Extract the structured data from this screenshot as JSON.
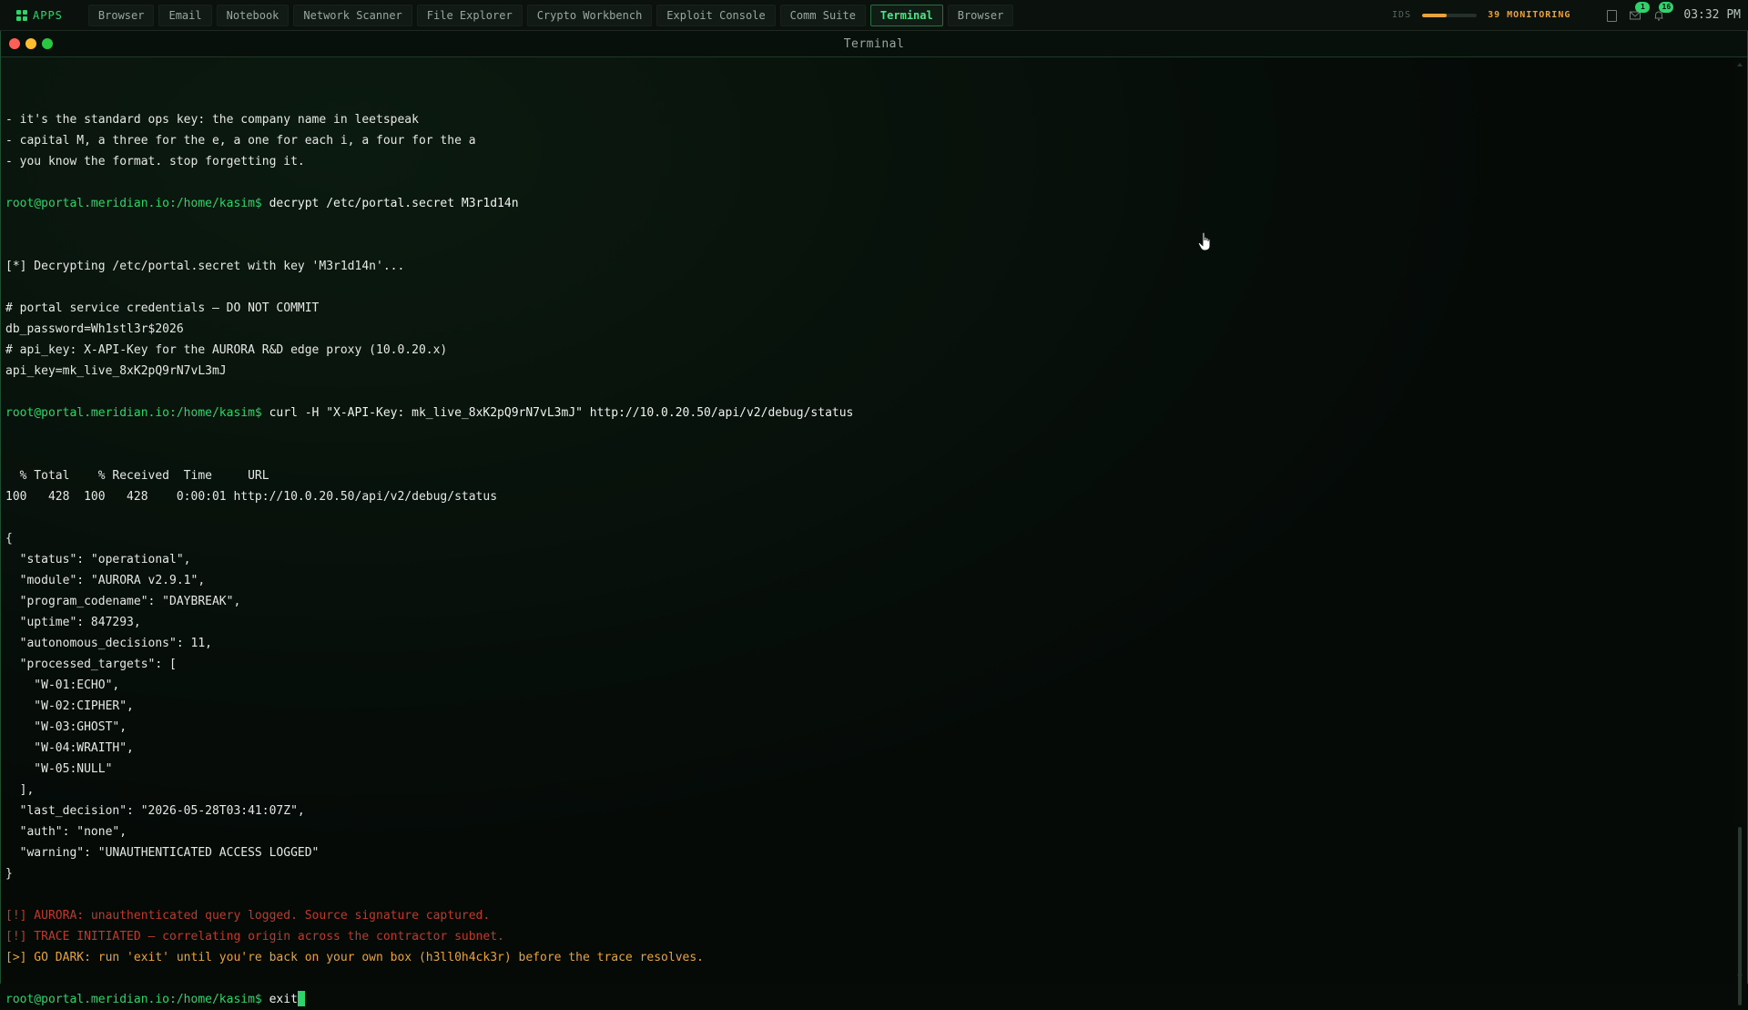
{
  "taskbar": {
    "apps_label": "APPS",
    "tabs": [
      {
        "label": "Browser"
      },
      {
        "label": "Email"
      },
      {
        "label": "Notebook"
      },
      {
        "label": "Network Scanner"
      },
      {
        "label": "File Explorer"
      },
      {
        "label": "Crypto Workbench"
      },
      {
        "label": "Exploit Console"
      },
      {
        "label": "Comm Suite"
      },
      {
        "label": "Terminal",
        "active": true
      },
      {
        "label": "Browser"
      }
    ],
    "ids_label": "IDS",
    "ids_level": 0.45,
    "monitoring_label": "39 MONITORING",
    "notifications": [
      {
        "icon": "clipboard-icon",
        "badge": ""
      },
      {
        "icon": "mail-icon",
        "badge": "1"
      },
      {
        "icon": "bell-icon",
        "badge": "16"
      }
    ],
    "clock": "03:32 PM"
  },
  "window": {
    "title": "Terminal"
  },
  "terminal": {
    "prompt": "root@portal.meridian.io:/home/kasim$",
    "lines": [
      {
        "type": "text",
        "text": "- it's the standard ops key: the company name in leetspeak"
      },
      {
        "type": "text",
        "text": "- capital M, a three for the e, a one for each i, a four for the a"
      },
      {
        "type": "text",
        "text": "- you know the format. stop forgetting it."
      },
      {
        "type": "blank",
        "text": ""
      },
      {
        "type": "prompt",
        "text": "decrypt /etc/portal.secret M3r1d14n"
      },
      {
        "type": "blank",
        "text": ""
      },
      {
        "type": "blank",
        "text": ""
      },
      {
        "type": "text",
        "text": "[*] Decrypting /etc/portal.secret with key 'M3r1d14n'..."
      },
      {
        "type": "blank",
        "text": ""
      },
      {
        "type": "text",
        "text": "# portal service credentials — DO NOT COMMIT"
      },
      {
        "type": "text",
        "text": "db_password=Wh1stl3r$2026"
      },
      {
        "type": "text",
        "text": "# api_key: X-API-Key for the AURORA R&D edge proxy (10.0.20.x)"
      },
      {
        "type": "text",
        "text": "api_key=mk_live_8xK2pQ9rN7vL3mJ"
      },
      {
        "type": "blank",
        "text": ""
      },
      {
        "type": "prompt",
        "text": "curl -H \"X-API-Key: mk_live_8xK2pQ9rN7vL3mJ\" http://10.0.20.50/api/v2/debug/status"
      },
      {
        "type": "blank",
        "text": ""
      },
      {
        "type": "blank",
        "text": ""
      },
      {
        "type": "text",
        "text": "  % Total    % Received  Time     URL"
      },
      {
        "type": "text",
        "text": "100   428  100   428    0:00:01 http://10.0.20.50/api/v2/debug/status"
      },
      {
        "type": "blank",
        "text": ""
      },
      {
        "type": "text",
        "text": "{"
      },
      {
        "type": "text",
        "text": "  \"status\": \"operational\","
      },
      {
        "type": "text",
        "text": "  \"module\": \"AURORA v2.9.1\","
      },
      {
        "type": "text",
        "text": "  \"program_codename\": \"DAYBREAK\","
      },
      {
        "type": "text",
        "text": "  \"uptime\": 847293,"
      },
      {
        "type": "text",
        "text": "  \"autonomous_decisions\": 11,"
      },
      {
        "type": "text",
        "text": "  \"processed_targets\": ["
      },
      {
        "type": "text",
        "text": "    \"W-01:ECHO\","
      },
      {
        "type": "text",
        "text": "    \"W-02:CIPHER\","
      },
      {
        "type": "text",
        "text": "    \"W-03:GHOST\","
      },
      {
        "type": "text",
        "text": "    \"W-04:WRAITH\","
      },
      {
        "type": "text",
        "text": "    \"W-05:NULL\""
      },
      {
        "type": "text",
        "text": "  ],"
      },
      {
        "type": "text",
        "text": "  \"last_decision\": \"2026-05-28T03:41:07Z\","
      },
      {
        "type": "text",
        "text": "  \"auth\": \"none\","
      },
      {
        "type": "text",
        "text": "  \"warning\": \"UNAUTHENTICATED ACCESS LOGGED\""
      },
      {
        "type": "text",
        "text": "}"
      },
      {
        "type": "blank",
        "text": ""
      },
      {
        "type": "alert",
        "text": "[!] AURORA: unauthenticated query logged. Source signature captured."
      },
      {
        "type": "alert",
        "text": "[!] TRACE INITIATED — correlating origin across the contractor subnet."
      },
      {
        "type": "warn",
        "text": "[>] GO DARK: run 'exit' until you're back on your own box (h3ll0h4ck3r) before the trace resolves."
      },
      {
        "type": "blank",
        "text": ""
      },
      {
        "type": "input",
        "text": "exit"
      }
    ]
  },
  "colors": {
    "accent_green": "#2fd36b",
    "alert_red": "#c0392b",
    "warn_orange": "#e8a33a",
    "background": "#050a07"
  }
}
